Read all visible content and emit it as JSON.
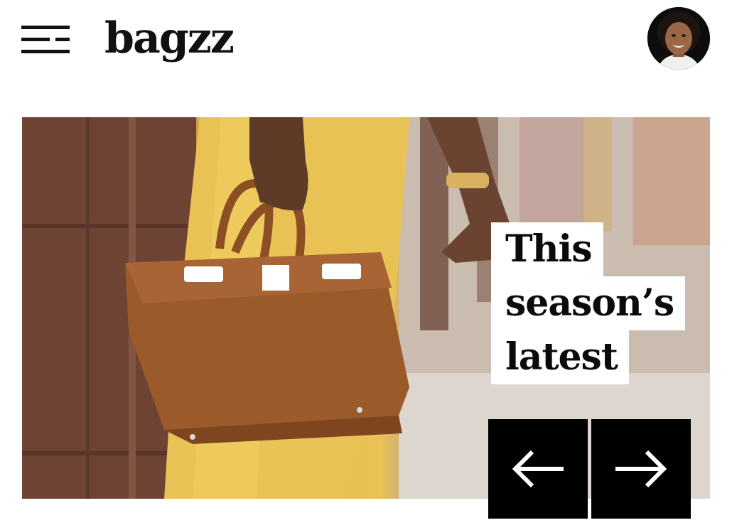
{
  "header": {
    "brand": "bagzz",
    "menu_icon": "menu-icon",
    "avatar_label": "user-avatar"
  },
  "hero": {
    "headline_lines": [
      "This",
      "season’s",
      "latest"
    ],
    "prev_icon": "arrow-left-icon",
    "next_icon": "arrow-right-icon"
  },
  "colors": {
    "background": "#ffffff",
    "text": "#0b0b0b",
    "button": "#000000",
    "bag": "#9b5a2a",
    "dress": "#e9c255"
  }
}
